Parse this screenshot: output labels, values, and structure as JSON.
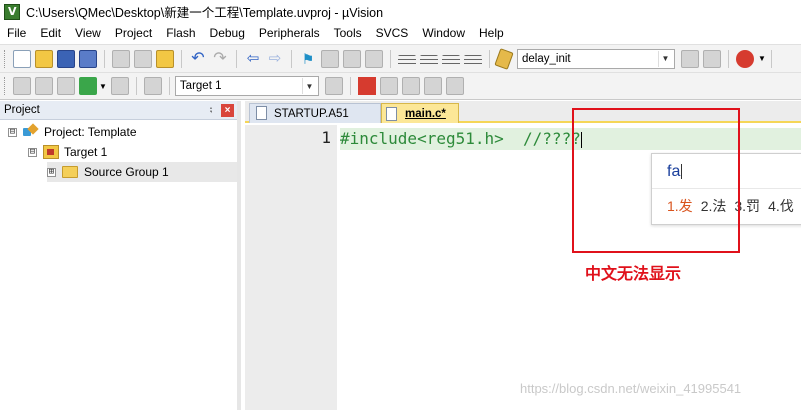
{
  "window": {
    "title": "C:\\Users\\QMec\\Desktop\\新建一个工程\\Template.uvproj - µVision"
  },
  "menubar": {
    "items": [
      "File",
      "Edit",
      "View",
      "Project",
      "Flash",
      "Debug",
      "Peripherals",
      "Tools",
      "SVCS",
      "Window",
      "Help"
    ]
  },
  "toolbar": {
    "function_select": "delay_init",
    "target_select": "Target 1"
  },
  "project_panel": {
    "title": "Project",
    "pin": "⨟",
    "close": "×",
    "tree": {
      "root_expander": "⊟",
      "root": "Project: Template",
      "target_expander": "⊟",
      "target": "Target 1",
      "group_expander": "⊞",
      "group": "Source Group 1"
    }
  },
  "editor": {
    "tabs": [
      {
        "label": "STARTUP.A51"
      },
      {
        "label": "main.c*"
      }
    ],
    "line_number": "1",
    "code": {
      "include": "#include<reg51.h>",
      "spacing": "  ",
      "comment": "//????"
    }
  },
  "ime": {
    "pinyin": "fa",
    "candidates": [
      "1.发",
      "2.法",
      "3.罚",
      "4.伐"
    ]
  },
  "annotation": {
    "text": "中文无法显示",
    "color": "#e0111b"
  },
  "watermark": "https://blog.csdn.net/weixin_41995541",
  "colors": {
    "code_line_highlight": "#e1f1df",
    "active_tab": "#fce797",
    "comment": "#2d8a3a"
  }
}
